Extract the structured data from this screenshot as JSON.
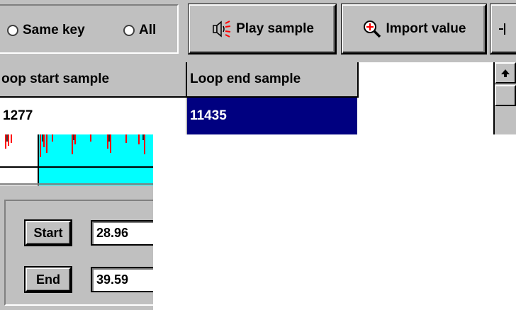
{
  "toolbar": {
    "radio_same_key": "Same key",
    "radio_all": "All",
    "play_sample": "Play sample",
    "import_value": "Import value"
  },
  "grid": {
    "headers": [
      "oop start sample",
      "Loop end sample"
    ],
    "row": [
      "1277",
      "11435"
    ]
  },
  "controls": {
    "start_label": "Start",
    "start_value": "28.96",
    "end_label": "End",
    "end_value": "39.59"
  },
  "colors": {
    "face": "#c0c0c0",
    "selection": "#000080",
    "waveform_fill": "#00ffff",
    "waveform_line": "#ff0000"
  },
  "icons": {
    "play": "speaker-icon",
    "import": "magnifier-plus-icon",
    "overflow": "marker-icon",
    "scroll_up": "arrow-up-icon"
  }
}
